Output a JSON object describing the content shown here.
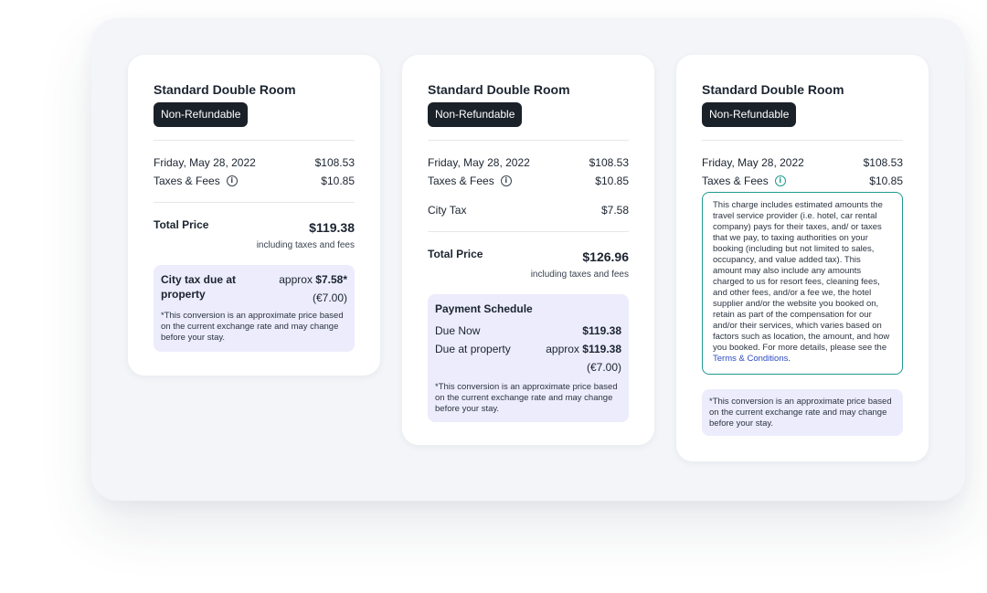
{
  "cards": [
    {
      "room_title": "Standard Double Room",
      "badge": "Non-Refundable",
      "date_label": "Friday, May 28, 2022",
      "date_price": "$108.53",
      "taxes_label": "Taxes & Fees",
      "taxes_value": "$10.85",
      "total_label": "Total Price",
      "total_value": "$119.38",
      "total_note": "including taxes and fees",
      "city_tax_label": "City tax due at property",
      "city_tax_prefix": "approx",
      "city_tax_value": "$7.58*",
      "city_tax_local": "(€7.00)",
      "disclaimer": "*This conversion is an approximate price based on the current exchange rate and may change before your stay."
    },
    {
      "room_title": "Standard Double Room",
      "badge": "Non-Refundable",
      "date_label": "Friday, May 28, 2022",
      "date_price": "$108.53",
      "taxes_label": "Taxes & Fees",
      "taxes_value": "$10.85",
      "city_tax_label": "City Tax",
      "city_tax_value": "$7.58",
      "total_label": "Total Price",
      "total_value": "$126.96",
      "total_note": "including taxes and fees",
      "schedule_title": "Payment Schedule",
      "due_now_label": "Due Now",
      "due_now_value": "$119.38",
      "due_property_label": "Due at property",
      "due_property_prefix": "approx",
      "due_property_value": "$119.38",
      "due_property_local": "(€7.00)",
      "disclaimer": "*This conversion is an approximate price based on the current exchange rate and may change before your stay."
    },
    {
      "room_title": "Standard Double Room",
      "badge": "Non-Refundable",
      "date_label": "Friday, May 28, 2022",
      "date_price": "$108.53",
      "taxes_label": "Taxes & Fees",
      "taxes_value": "$10.85",
      "tooltip_text": "This charge includes estimated amounts the travel service provider (i.e. hotel, car rental company) pays for their taxes, and/ or taxes that we pay, to taxing authorities on your booking (including but not limited to sales, occupancy, and value added tax). This amount may also include any amounts charged to us for resort fees, cleaning fees, and other fees, and/or a fee we, the hotel supplier and/or the website you booked on, retain as part of the compensation for our and/or their services, which varies based on factors such as location, the amount, and how you booked. For more details, please see the ",
      "tooltip_link": "Terms & Conditions",
      "tooltip_end": ".",
      "disclaimer": "*This conversion is an approximate price based on the current exchange rate and may change before your stay."
    }
  ],
  "icons": {
    "info": "info-icon"
  },
  "colors": {
    "badge_bg": "#1a2129",
    "box_bg": "#ececfc",
    "tooltip_border": "#1f9a8f",
    "link": "#2b4bc0"
  }
}
